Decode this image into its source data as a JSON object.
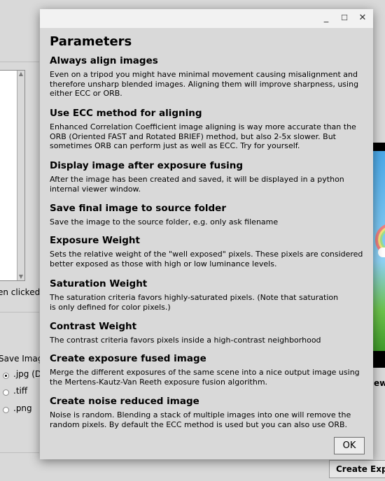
{
  "background": {
    "clicked_label": "en clicked",
    "save_image_label": "Save Imag",
    "formats": [
      {
        "label": ".jpg (D",
        "selected": true
      },
      {
        "label": ".tiff",
        "selected": false
      },
      {
        "label": ".png",
        "selected": false
      }
    ],
    "side_label": "ew",
    "create_button": "Create Exp"
  },
  "dialog": {
    "titlebar": {
      "minimize_icon": "minimize-icon",
      "maximize_icon": "maximize-icon",
      "close_icon": "close-icon"
    },
    "title": "Parameters",
    "sections": [
      {
        "heading": "Always align images",
        "text": "Even on a tripod you might have minimal movement causing misalignment and\ntherefore unsharp blended images. Aligning them will improve sharpness, using\neither ECC or ORB."
      },
      {
        "heading": "Use ECC method for aligning",
        "text": "Enhanced Correlation Coefficient image aligning is way more accurate than the\nORB (Oriented FAST and Rotated BRIEF) method, but also 2-5x slower. But\nsometimes ORB can perform just as well as ECC. Try for yourself."
      },
      {
        "heading": "Display image after exposure fusing",
        "text": "After the image has been created and saved, it will be displayed in a python\ninternal viewer window."
      },
      {
        "heading": "Save final image to source folder",
        "text": "Save the image to the source folder, e.g. only ask filename"
      },
      {
        "heading": "Exposure Weight",
        "text": "Sets the relative weight of the \"well exposed\" pixels. These pixels are considered\nbetter exposed as those with high or low luminance levels."
      },
      {
        "heading": "Saturation Weight",
        "text": "The saturation criteria favors highly-saturated pixels. (Note that saturation\nis only defined for color pixels.)"
      },
      {
        "heading": "Contrast Weight",
        "text": "The contrast criteria favors pixels inside a high-contrast neighborhood"
      },
      {
        "heading": "Create exposure fused image",
        "text": "Merge the different exposures of the same scene into a nice output image using\nthe Mertens-Kautz-Van Reeth exposure fusion algorithm."
      },
      {
        "heading": "Create noise reduced image",
        "text": "Noise is random. Blending a stack of multiple images into one will remove the\nrandom pixels. By default the ECC method is used but you can also use ORB."
      }
    ],
    "ok_button": "OK"
  }
}
